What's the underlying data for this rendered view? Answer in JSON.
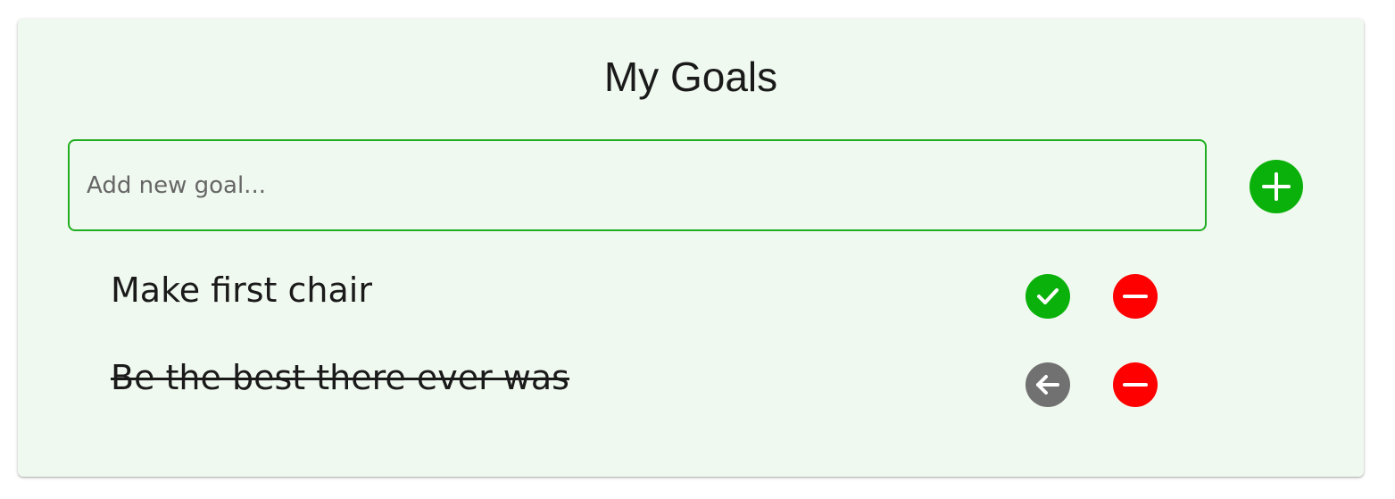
{
  "title": "My Goals",
  "input": {
    "placeholder": "Add new goal...",
    "value": ""
  },
  "add_button": {
    "icon": "plus-icon",
    "color": "#0bb10b"
  },
  "goals": [
    {
      "text": "Make first chair",
      "completed": false,
      "toggle_icon": "check-icon",
      "toggle_color": "#0bb10b",
      "remove_icon": "minus-icon",
      "remove_color": "#ff0000"
    },
    {
      "text": "Be the best there ever was",
      "completed": true,
      "toggle_icon": "arrow-left-icon",
      "toggle_color": "#717171",
      "remove_icon": "minus-icon",
      "remove_color": "#ff0000"
    }
  ],
  "colors": {
    "background": "#f0f9f0",
    "accent": "#0bb10b",
    "input_border": "#1fae1f",
    "danger": "#ff0000",
    "neutral": "#717171"
  }
}
